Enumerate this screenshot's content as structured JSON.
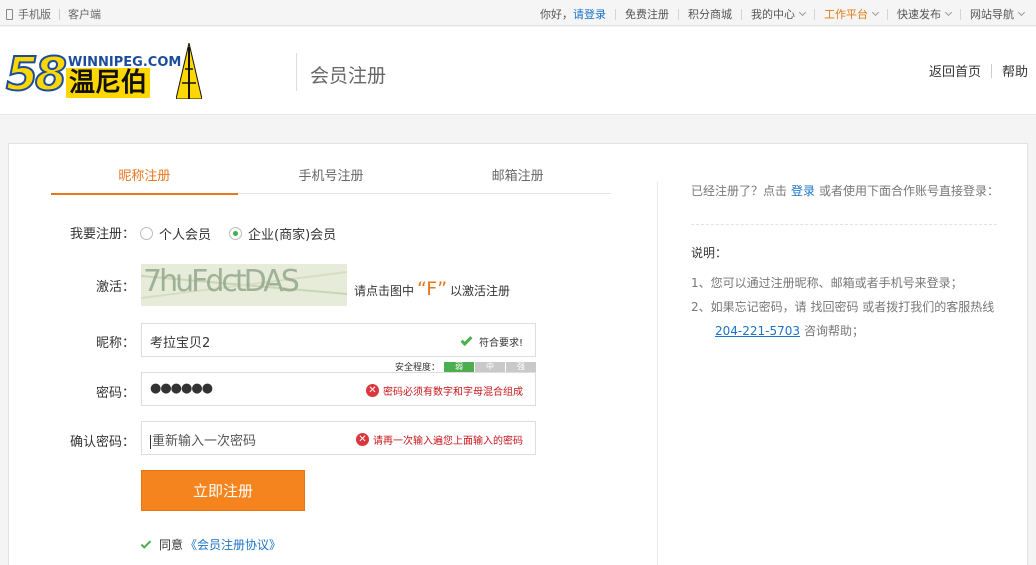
{
  "topbar": {
    "mobile": "手机版",
    "client": "客户端",
    "greeting": "你好，",
    "login": "请登录",
    "register": "免费注册",
    "points_mall": "积分商城",
    "my_center": "我的中心",
    "workbench": "工作平台",
    "quick_post": "快速发布",
    "site_nav": "网站导航"
  },
  "header": {
    "logo_number": "58",
    "logo_domain": "WINNIPEG.COM",
    "logo_name": "温尼伯",
    "page_title": "会员注册",
    "home": "返回首页",
    "help": "帮助"
  },
  "tabs": [
    {
      "label": "昵称注册",
      "active": true
    },
    {
      "label": "手机号注册",
      "active": false
    },
    {
      "label": "邮箱注册",
      "active": false
    }
  ],
  "form": {
    "type_label": "我要注册：",
    "type_options": [
      {
        "label": "个人会员",
        "selected": false
      },
      {
        "label": "企业(商家)会员",
        "selected": true
      }
    ],
    "activate_label": "激活：",
    "captcha_text": "7huFdctDAS",
    "activate_hint_pre": "请点击图中",
    "activate_hint_char": "“F”",
    "activate_hint_post": "以激活注册",
    "nickname_label": "昵称：",
    "nickname_value": "考拉宝贝2",
    "nickname_msg": "符合要求!",
    "strength_label": "安全程度：",
    "strength_levels": [
      "弱",
      "中",
      "强"
    ],
    "strength_level": 1,
    "password_label": "密码：",
    "password_value": "●●●●●●",
    "password_msg": "密码必须有数字和字母混合组成",
    "confirm_label": "确认密码：",
    "confirm_placeholder": "重新输入一次密码",
    "confirm_msg": "请再一次输入遍您上面输入的密码",
    "submit": "立即注册",
    "agree_pre": "同意",
    "agree_link": "《会员注册协议》"
  },
  "side": {
    "registered_pre": "已经注册了？点击",
    "registered_link": "登录",
    "registered_post": "或者使用下面合作账号直接登录：",
    "notes_title": "说明：",
    "note1": "1、您可以通过注册昵称、邮箱或者手机号来登录；",
    "note2": "2、如果忘记密码，请 找回密码 或者拨打我们的客服热线",
    "phone": "204-221-5703",
    "phone_post": "咨询帮助；"
  },
  "colors": {
    "accent": "#f5841f",
    "link": "#1a73c8",
    "ok": "#4cae4c",
    "error": "#c8151b"
  }
}
